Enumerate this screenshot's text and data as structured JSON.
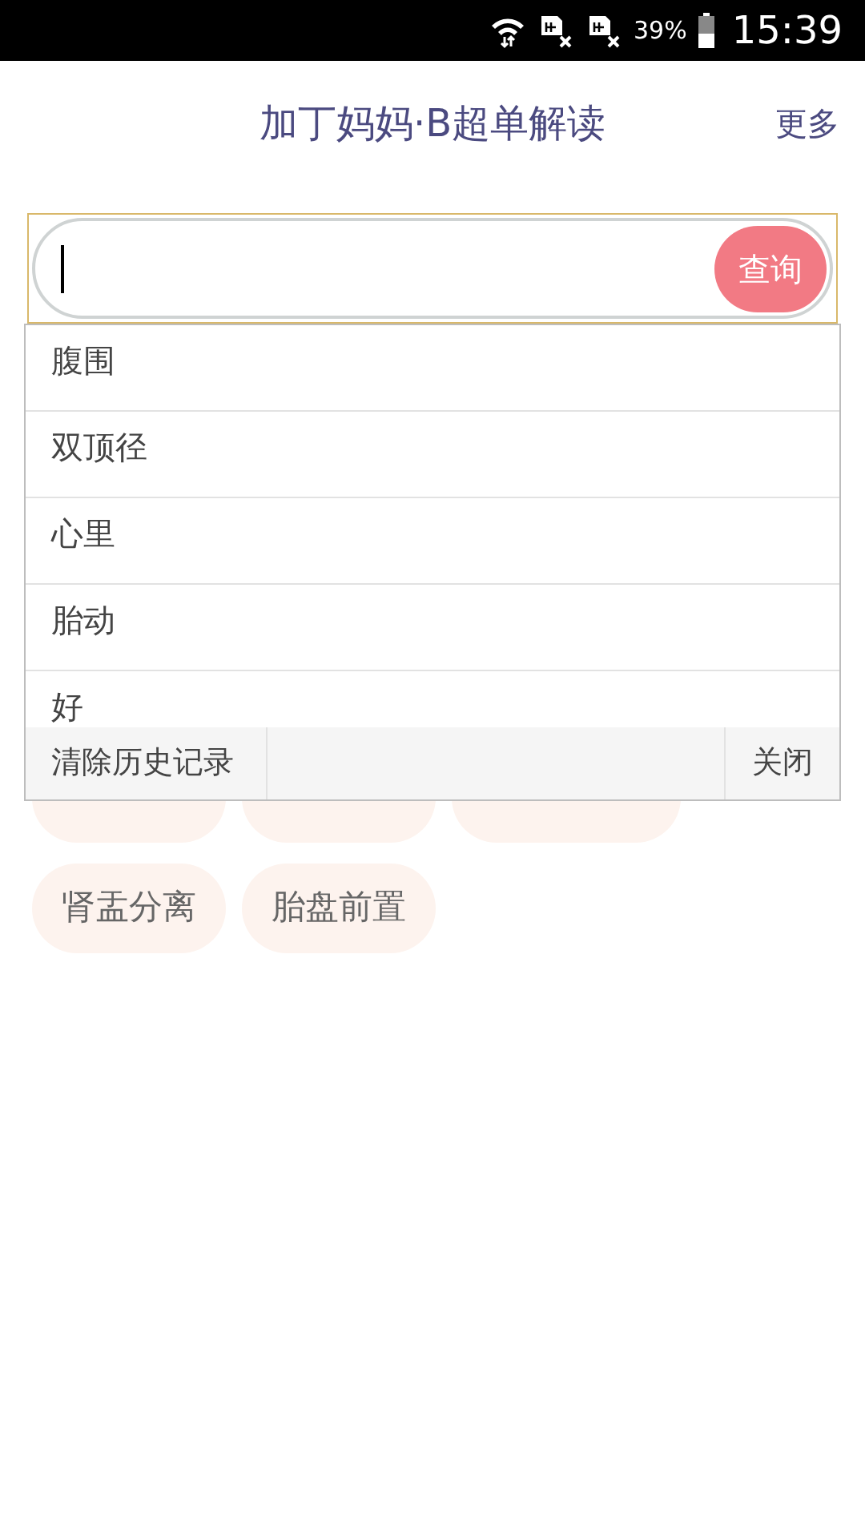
{
  "status_bar": {
    "battery": "39%",
    "time": "15:39"
  },
  "header": {
    "title": "加丁妈妈·B超单解读",
    "more": "更多"
  },
  "search": {
    "button": "查询"
  },
  "suggestions": {
    "items": [
      "腹围",
      "双顶径",
      "心里",
      "胎动",
      "好"
    ],
    "clear": "清除历史记录",
    "close": "关闭"
  },
  "tags": [
    {
      "kind": "covered"
    },
    {
      "kind": "covered"
    },
    {
      "kind": "covered"
    },
    {
      "kind": "tag",
      "label": "肾盂分离"
    },
    {
      "kind": "tag",
      "label": "胎盘前置"
    }
  ]
}
